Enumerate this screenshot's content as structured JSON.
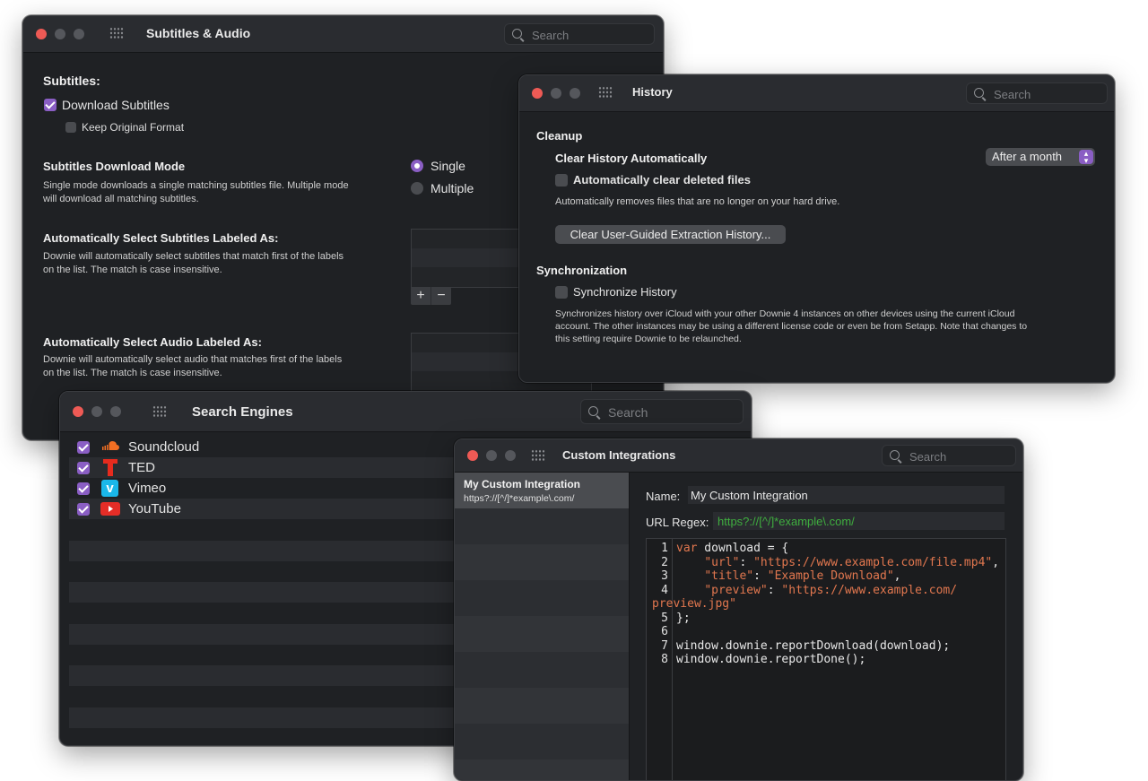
{
  "colors": {
    "accent": "#8a5ec4",
    "window_bg": "#1f2124",
    "code_string": "#e2774f",
    "code_keyword": "#e2774f",
    "regex_green": "#3fae3f"
  },
  "subtitles_window": {
    "title": "Subtitles & Audio",
    "search_placeholder": "Search",
    "subtitles_heading": "Subtitles:",
    "download_subtitles": "Download Subtitles",
    "download_subtitles_checked": true,
    "keep_original_format": "Keep Original Format",
    "keep_original_format_checked": false,
    "mode_heading": "Subtitles Download Mode",
    "mode_desc_line1": "Single mode downloads a single matching subtitles file. Multiple mode",
    "mode_desc_line2": "will download all matching subtitles.",
    "mode_single": "Single",
    "mode_multiple": "Multiple",
    "mode_selected": "Single",
    "auto_subs_heading": "Automatically Select Subtitles Labeled As:",
    "auto_subs_desc_line1": "Downie will automatically select subtitles that match first of the labels",
    "auto_subs_desc_line2": "on the list. The match is case insensitive.",
    "add_label": "+",
    "remove_label": "−",
    "auto_audio_heading": "Automatically Select Audio Labeled As:",
    "auto_audio_desc_line1": "Downie will automatically select audio that matches first of the labels",
    "auto_audio_desc_line2": "on the list. The match is case insensitive."
  },
  "history_window": {
    "title": "History",
    "search_placeholder": "Search",
    "cleanup_heading": "Cleanup",
    "clear_auto_label": "Clear History Automatically",
    "clear_auto_value": "After a month",
    "auto_clear_deleted": "Automatically clear deleted files",
    "auto_clear_deleted_checked": false,
    "auto_clear_desc": "Automatically removes files that are no longer on your hard drive.",
    "clear_extraction_button": "Clear User-Guided Extraction History...",
    "sync_heading": "Synchronization",
    "sync_label": "Synchronize History",
    "sync_checked": false,
    "sync_desc_line1": "Synchronizes history over iCloud with your other Downie 4 instances on other devices using the current iCloud",
    "sync_desc_line2": "account. The other instances may be using a different license code or even be from Setapp. Note that changes to",
    "sync_desc_line3": "this setting require Downie to be relaunched."
  },
  "search_engines_window": {
    "title": "Search Engines",
    "search_placeholder": "Search",
    "engines": [
      {
        "name": "Soundcloud",
        "enabled": true,
        "icon": "soundcloud-icon",
        "color": "#f26f23"
      },
      {
        "name": "TED",
        "enabled": true,
        "icon": "ted-icon",
        "color": "#e62b1e"
      },
      {
        "name": "Vimeo",
        "enabled": true,
        "icon": "vimeo-icon",
        "color": "#1ab7ea"
      },
      {
        "name": "YouTube",
        "enabled": true,
        "icon": "youtube-icon",
        "color": "#e52d27"
      }
    ]
  },
  "integrations_window": {
    "title": "Custom Integrations",
    "search_placeholder": "Search",
    "list": [
      {
        "name": "My Custom Integration",
        "regex": "https?://[^/]*example\\.com/"
      }
    ],
    "name_label": "Name:",
    "name_value": "My Custom Integration",
    "regex_label": "URL Regex:",
    "regex_value": "https?://[^/]*example\\.com/",
    "code_lines": [
      {
        "n": "1",
        "text": "var download = {"
      },
      {
        "n": "2",
        "text": "    \"url\": \"https://www.example.com/file.mp4\","
      },
      {
        "n": "3",
        "text": "    \"title\": \"Example Download\","
      },
      {
        "n": "4",
        "text": "    \"preview\": \"https://www.example.com/"
      },
      {
        "n": "",
        "text": "preview.jpg\""
      },
      {
        "n": "5",
        "text": "};"
      },
      {
        "n": "6",
        "text": ""
      },
      {
        "n": "7",
        "text": "window.downie.reportDownload(download);"
      },
      {
        "n": "8",
        "text": "window.downie.reportDone();"
      }
    ]
  }
}
